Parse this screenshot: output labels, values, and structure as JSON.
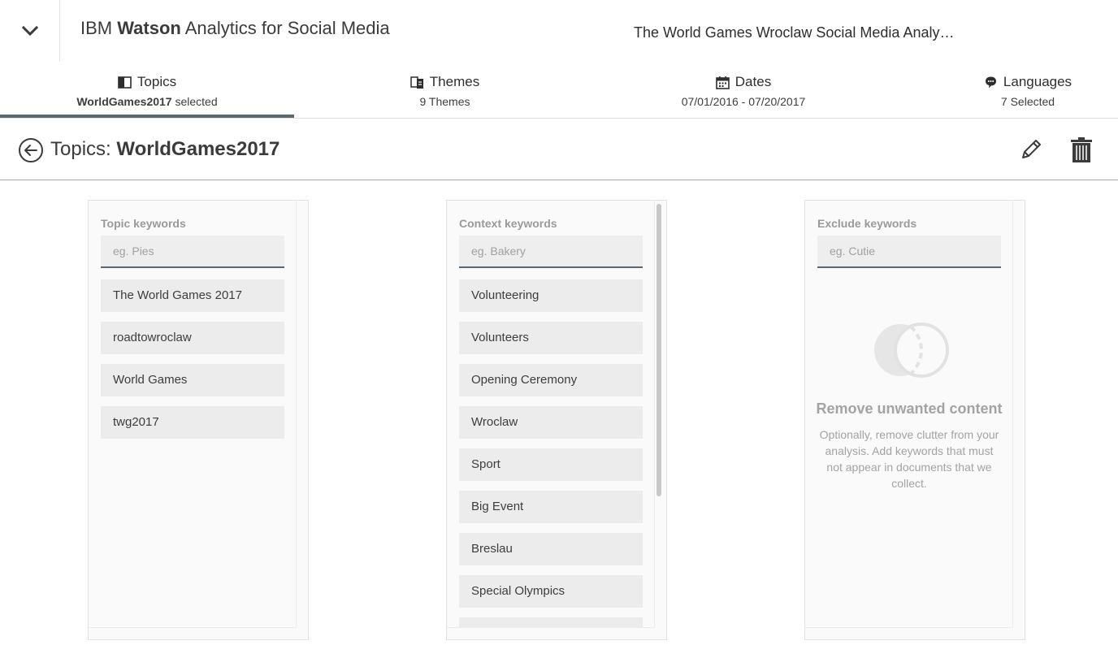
{
  "header": {
    "app_title_prefix": "IBM ",
    "app_title_brand": "Watson",
    "app_title_suffix": " Analytics for Social Media",
    "project_title": "The World Games Wroclaw Social Media Analy…"
  },
  "tabs": [
    {
      "label": "Topics",
      "sub_bold": "WorldGames2017",
      "sub": " selected",
      "icon": "topics-icon"
    },
    {
      "label": "Themes",
      "sub": "9 Themes",
      "icon": "themes-icon"
    },
    {
      "label": "Dates",
      "sub": "07/01/2016 - 07/20/2017",
      "icon": "calendar-icon"
    },
    {
      "label": "Languages",
      "sub": "7 Selected",
      "icon": "speech-bubble-icon"
    }
  ],
  "section": {
    "title_prefix": "Topics: ",
    "topic_name": "WorldGames2017"
  },
  "panels": {
    "topic": {
      "label": "Topic keywords",
      "placeholder": "eg. Pies",
      "items": [
        "The World Games 2017",
        "roadtowroclaw",
        "World Games",
        "twg2017"
      ]
    },
    "context": {
      "label": "Context keywords",
      "placeholder": "eg. Bakery",
      "items": [
        "Volunteering",
        "Volunteers",
        "Opening Ceremony",
        "Wroclaw",
        "Sport",
        "Big Event",
        "Breslau",
        "Special Olympics",
        ""
      ]
    },
    "exclude": {
      "label": "Exclude keywords",
      "placeholder": "eg. Cutie",
      "empty_title": "Remove unwanted content",
      "empty_desc": "Optionally, remove clutter from your analysis. Add keywords that must not appear in documents that we collect."
    }
  },
  "colors": {
    "accent": "#5a6872",
    "muted_text": "#a3a3a3",
    "item_bg": "#ececec"
  }
}
